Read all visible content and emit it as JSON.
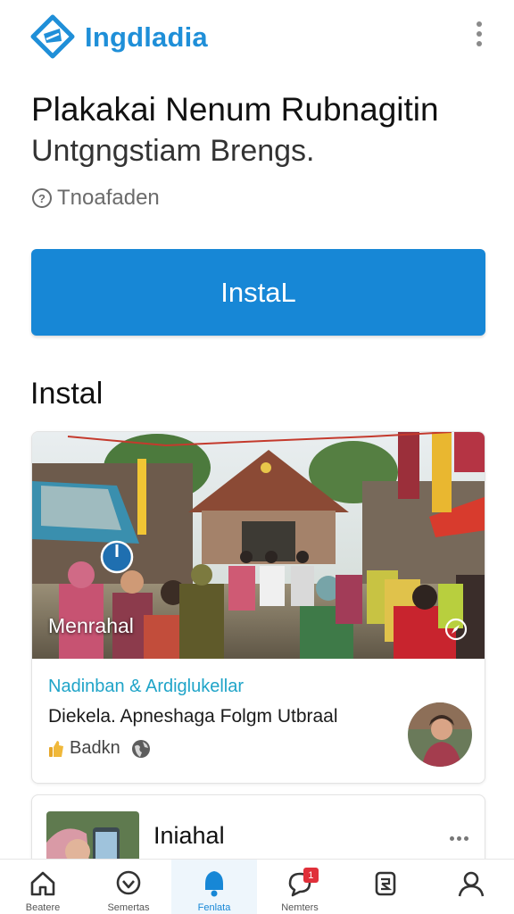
{
  "app": {
    "brand": "Ingdladia",
    "logo_icon": "chat-diamond-logo-icon",
    "menu_icon": "kebab-menu-icon",
    "accent_color": "#1787d6"
  },
  "hero": {
    "headline_line1": "Plakakai Nenum Rubnagitin",
    "headline_line2": "Untgngstiam Brengs.",
    "meta_icon": "clock-icon",
    "meta_text": "Tnoafaden",
    "install_label": "InstaL"
  },
  "section": {
    "title": "Instal"
  },
  "feed": {
    "card1": {
      "overlay_label": "Menrahal",
      "category": "Nadinban & Ardiglukellar",
      "description": "Diekela. Apneshaga Folgm Utbraal",
      "footer_text": "Badkn",
      "footer_icons": [
        "thumbs-up-icon",
        "globe-icon"
      ],
      "photo_icons": [
        "play-icon",
        "compass-icon"
      ]
    },
    "card2": {
      "title": "Iniahal",
      "more_icon": "more-horizontal-icon"
    }
  },
  "bottom_nav": {
    "items": [
      {
        "label": "Beatere",
        "icon": "home-icon"
      },
      {
        "label": "Semertas",
        "icon": "heart-chat-icon"
      },
      {
        "label": "Fenlata",
        "icon": "bell-icon",
        "active": true
      },
      {
        "label": "Nemters",
        "icon": "message-icon",
        "badge": "1"
      },
      {
        "label": "",
        "icon": "document-icon"
      },
      {
        "label": "",
        "icon": "profile-icon"
      }
    ]
  }
}
